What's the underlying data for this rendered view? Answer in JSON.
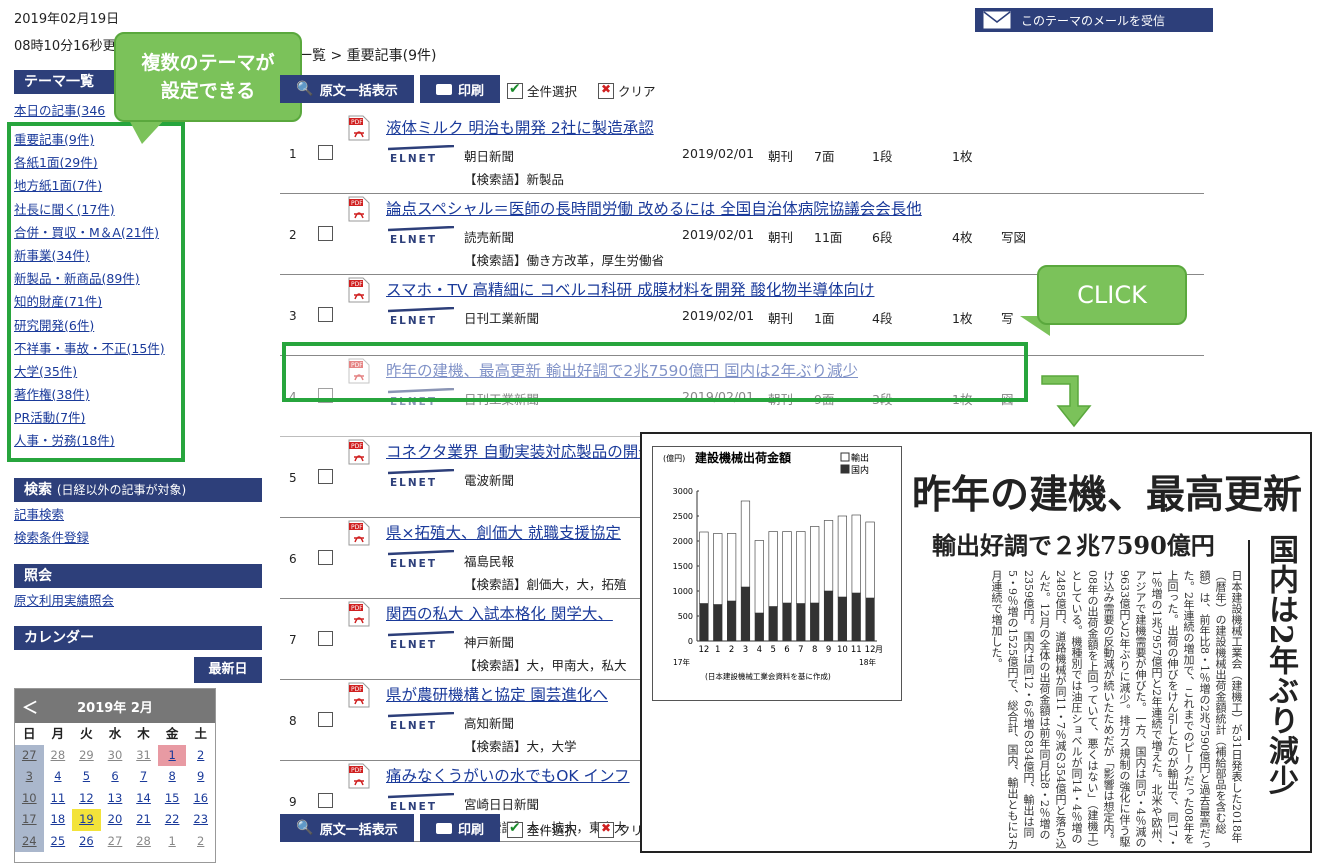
{
  "header": {
    "date": "2019年02月19日",
    "time": "08時10分16秒更",
    "mail_button": "このテーマのメールを受信",
    "breadcrumb": "一覧 > 重要記事(9件)"
  },
  "sidebar": {
    "theme_header": "テーマ一覧",
    "today": "本日の記事(346",
    "themes": [
      "重要記事(9件)",
      "各紙1面(29件)",
      "地方紙1面(7件)",
      "社長に聞く(17件)",
      "合併・買収・M＆A(21件)",
      "新事業(34件)",
      "新製品・新商品(89件)",
      "知的財産(71件)",
      "研究開発(6件)",
      "不祥事・事故・不正(15件)",
      "大学(35件)",
      "著作権(38件)",
      "PR活動(7件)",
      "人事・労務(18件)"
    ],
    "search_header": "検索",
    "search_note": "(日経以外の記事が対象)",
    "search_links": [
      "記事検索",
      "検索条件登録"
    ],
    "ref_header": "照会",
    "ref_link": "原文利用実績照会",
    "calendar_header": "カレンダー",
    "latest_button": "最新日"
  },
  "callout_themes": "複数のテーマが\n設定できる",
  "callout_click": "CLICK",
  "calendar": {
    "prev": "＜",
    "title": "2019年 2月",
    "weekdays": [
      "日",
      "月",
      "火",
      "水",
      "木",
      "金",
      "土"
    ],
    "rows": [
      [
        "27",
        "28",
        "29",
        "30",
        "31",
        "1",
        "2"
      ],
      [
        "3",
        "4",
        "5",
        "6",
        "7",
        "8",
        "9"
      ],
      [
        "10",
        "11",
        "12",
        "13",
        "14",
        "15",
        "16"
      ],
      [
        "17",
        "18",
        "19",
        "20",
        "21",
        "22",
        "23"
      ],
      [
        "24",
        "25",
        "26",
        "27",
        "28",
        "1",
        "2"
      ]
    ]
  },
  "toolbar": {
    "show_all": "原文一括表示",
    "print": "印刷",
    "select_all": "全件選択",
    "clear": "クリア"
  },
  "articles": [
    {
      "num": "1",
      "title": "液体ミルク 明治も開発 2社に製造承認",
      "source": "朝日新聞",
      "date": "2019/02/01",
      "edition": "朝刊",
      "page": "7面",
      "columns": "1段",
      "sheets": "1枚",
      "photo": "",
      "keywords": "【検索語】新製品"
    },
    {
      "num": "2",
      "title": "論点スペシャル＝医師の長時間労働 改めるには 全国自治体病院協議会会長他",
      "source": "読売新聞",
      "date": "2019/02/01",
      "edition": "朝刊",
      "page": "11面",
      "columns": "6段",
      "sheets": "4枚",
      "photo": "写図",
      "keywords": "【検索語】働き方改革，厚生労働省"
    },
    {
      "num": "3",
      "title": "スマホ・TV 高精細に コベルコ科研 成膜材料を開発 酸化物半導体向け",
      "source": "日刊工業新聞",
      "date": "2019/02/01",
      "edition": "朝刊",
      "page": "1面",
      "columns": "4段",
      "sheets": "1枚",
      "photo": "写",
      "keywords": ""
    },
    {
      "num": "4",
      "title": "昨年の建機、最高更新 輸出好調で2兆7590億円 国内は2年ぶり減少",
      "source": "日刊工業新聞",
      "date": "2019/02/01",
      "edition": "朝刊",
      "page": "9面",
      "columns": "3段",
      "sheets": "1枚",
      "photo": "図",
      "keywords": ""
    },
    {
      "num": "5",
      "title": "コネクタ業界 自動実装対応製品の開発を強化 品質向上や省人化に寄与",
      "source": "電波新聞",
      "date": "",
      "edition": "",
      "page": "",
      "columns": "",
      "sheets": "",
      "photo": "",
      "keywords": ""
    },
    {
      "num": "6",
      "title": "県×拓殖大、創価大 就職支援協定",
      "source": "福島民報",
      "date": "",
      "edition": "",
      "page": "",
      "columns": "",
      "sheets": "",
      "photo": "",
      "keywords": "【検索語】創価大，大，拓殖"
    },
    {
      "num": "7",
      "title": "関西の私大 入試本格化 関学大、",
      "source": "神戸新聞",
      "date": "",
      "edition": "",
      "page": "",
      "columns": "",
      "sheets": "",
      "photo": "",
      "keywords": "【検索語】大，甲南大，私大"
    },
    {
      "num": "8",
      "title": "県が農研機構と協定 園芸進化へ",
      "source": "高知新聞",
      "date": "",
      "edition": "",
      "page": "",
      "columns": "",
      "sheets": "",
      "photo": "",
      "keywords": "【検索語】大，大学"
    },
    {
      "num": "9",
      "title": "痛みなくうがいの水でもOK インフ",
      "source": "宮崎日日新聞",
      "date": "",
      "edition": "",
      "page": "",
      "columns": "",
      "sheets": "",
      "photo": "",
      "keywords": "【検索語】大，拡大，東京大"
    }
  ],
  "elnet_logo": "ELNET",
  "newspaper": {
    "headline": "昨年の建機、最高更新",
    "subheadline": "輸出好調で２兆7590億円",
    "vertical_headline": "国内は2年ぶり減少",
    "body": "日本建設機械工業会（建機工）が31日発表した2018年（暦年）の建設機械出荷金額統計（補給部品を含む総額）は、前年比8・1％増の2兆7590億円と過去最高だった。2年連続の増加で、これまでのピークだった08年を上回った。出荷の伸びをけん引したのが輸出で、同17・1％増の1兆7957億円と2年連続で増えた。北米や欧州、アジアで建機需要が伸びた。一方、国内は同5・4％減の9633億円と2年ぶりに減少。排ガス規制の強化に伴う駆け込み需要の反動減が続いたためだが「影響は想定内。08年の出荷金額を上回っていて、悪くはない」（建機工）としている。機種別では油圧ショベルが同14・4％増の2485億円、道路機械が同11・7％減の354億円と落ち込んだ。12月の全体の出荷金額は前年同月比8・2％増の2359億円。国内は同12・6％増の834億円、輸出は同5・9％増の1525億円で、総合計、国内、輸出ともに3カ月連続で増加した。"
  },
  "chart_data": {
    "type": "bar",
    "title": "建設機械出荷金額",
    "ylabel": "(億円)",
    "ylim": [
      0,
      3000
    ],
    "yticks": [
      0,
      500,
      1000,
      1500,
      2000,
      2500,
      3000
    ],
    "categories": [
      "12",
      "1",
      "2",
      "3",
      "4",
      "5",
      "6",
      "7",
      "8",
      "9",
      "10",
      "11",
      "12"
    ],
    "x_unit": "月",
    "year_labels": [
      "17年",
      "18年"
    ],
    "legend": "top-right",
    "source_note": "(日本建設機械工業会資料を基に作成)",
    "series": [
      {
        "name": "国内",
        "color": "#333333",
        "values": [
          750,
          730,
          800,
          1080,
          560,
          690,
          760,
          750,
          760,
          1000,
          880,
          960,
          860
        ]
      },
      {
        "name": "輸出",
        "color": "#ffffff",
        "values": [
          1430,
          1420,
          1350,
          1720,
          1450,
          1500,
          1430,
          1440,
          1530,
          1410,
          1620,
          1560,
          1520
        ]
      }
    ]
  }
}
